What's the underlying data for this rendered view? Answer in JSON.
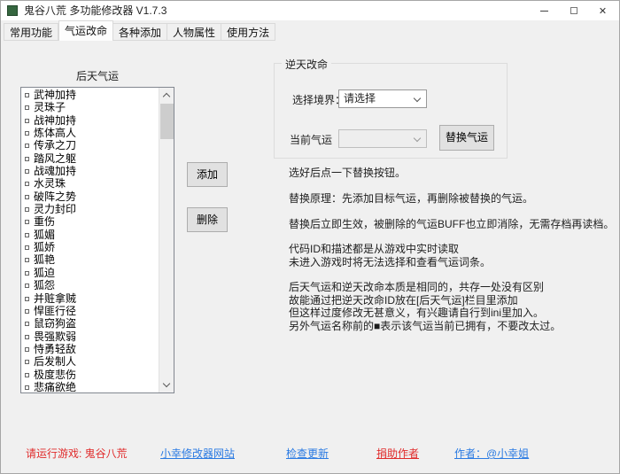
{
  "window": {
    "title": "鬼谷八荒 多功能修改器  V1.7.3",
    "icons": {
      "minimize": "minimize",
      "maximize": "maximize",
      "close": "✕"
    }
  },
  "tabs": [
    {
      "label": "常用功能",
      "active": false
    },
    {
      "label": "气运改命",
      "active": true
    },
    {
      "label": "各种添加",
      "active": false
    },
    {
      "label": "人物属性",
      "active": false
    },
    {
      "label": "使用方法",
      "active": false
    }
  ],
  "list_panel": {
    "title": "后天气运",
    "item_prefix_icon": "square-icon",
    "items": [
      "武神加持",
      "灵珠子",
      "战神加持",
      "炼体高人",
      "传承之刀",
      "踏风之躯",
      "战魂加持",
      "水灵珠",
      "破阵之势",
      "灵力封印",
      "重伤",
      "狐媚",
      "狐娇",
      "狐艳",
      "狐迫",
      "狐怨",
      "并赃拿贼",
      "悍匪行径",
      "鼠窃狗盗",
      "畏强欺弱",
      "恃勇轻敌",
      "后发制人",
      "极度悲伤",
      "悲痛欲绝"
    ]
  },
  "actions": {
    "add": "添加",
    "remove": "删除"
  },
  "groupbox": {
    "title": "逆天改命",
    "realm_label": "选择境界：",
    "realm_value": "请选择",
    "current_label": "当前气运",
    "current_value": "",
    "replace_button": "替换气运"
  },
  "notes": {
    "line1": "选好后点一下替换按钮。",
    "line2": "替换原理：先添加目标气运，再删除被替换的气运。",
    "line3": "替换后立即生效，被删除的气运BUFF也立即消除，无需存档再读档。",
    "line4a": "代码ID和描述都是从游戏中实时读取",
    "line4b": "未进入游戏时将无法选择和查看气运词条。",
    "line5a": "后天气运和逆天改命本质是相同的，共存一处没有区别",
    "line5b": "故能通过把逆天改命ID放在[后天气运]栏目里添加",
    "line5c": "但这样过度修改无甚意义，有兴趣请自行到ini里加入。",
    "line5d": "另外气运名称前的■表示该气运当前已拥有，不要改太过。"
  },
  "footer": {
    "run_game": "请运行游戏: 鬼谷八荒",
    "website": "小幸修改器网站",
    "check_update": "检查更新",
    "donate": "捐助作者",
    "author": "作者：@小幸姐"
  },
  "colors": {
    "status_red": "#e02b2b",
    "link_blue": "#2a7ae2",
    "window_icon_green": "#35663f"
  }
}
